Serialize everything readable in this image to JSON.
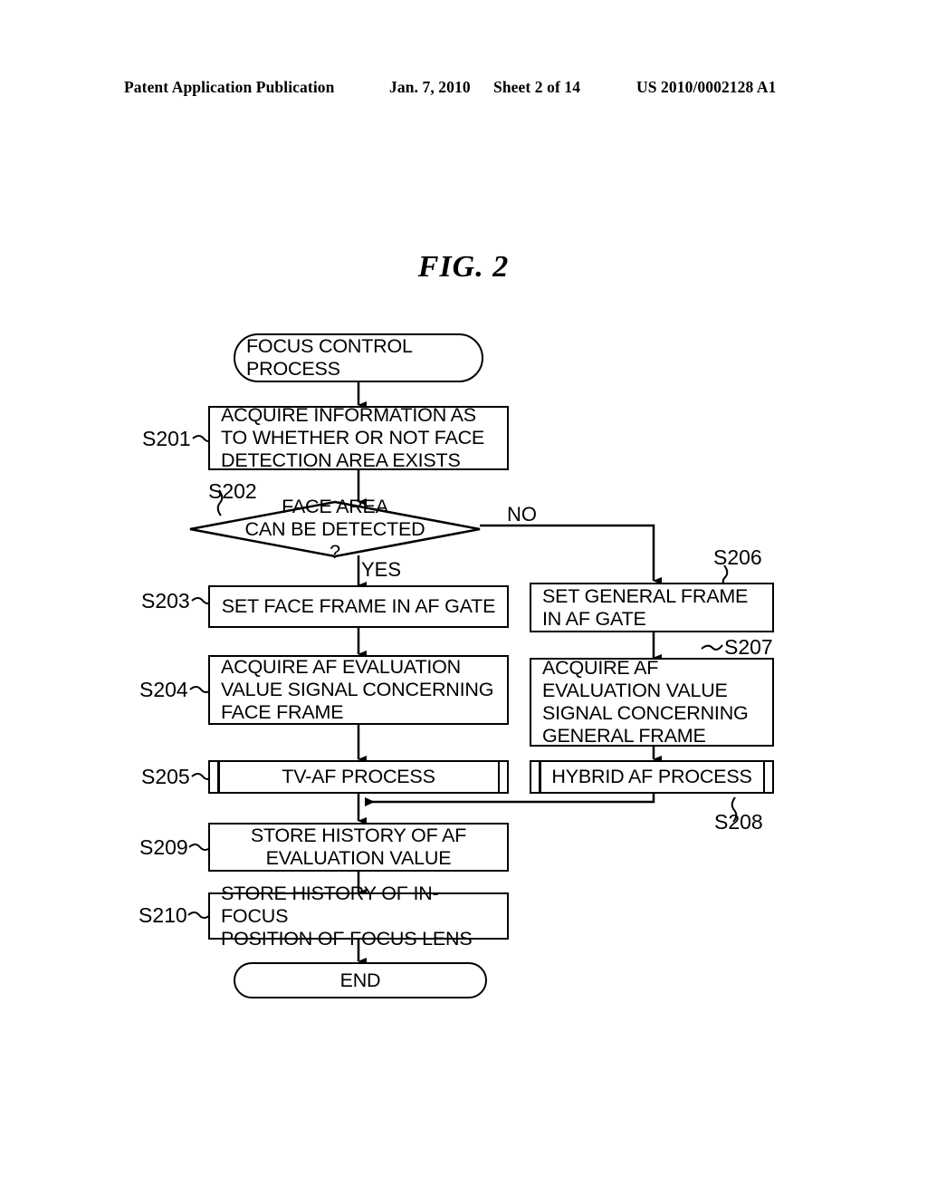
{
  "header": {
    "publication": "Patent Application Publication",
    "date": "Jan. 7, 2010",
    "sheet": "Sheet 2 of 14",
    "patent_number": "US 2010/0002128 A1"
  },
  "figure": {
    "caption": "FIG. 2"
  },
  "flowchart": {
    "start": {
      "label": "FOCUS CONTROL\nPROCESS"
    },
    "end": {
      "label": "END"
    },
    "steps": [
      {
        "ref": "S201",
        "label": "ACQUIRE INFORMATION AS\nTO WHETHER OR NOT FACE\nDETECTION AREA EXISTS"
      },
      {
        "ref": "S202",
        "label": "FACE AREA\nCAN BE DETECTED\n?"
      },
      {
        "ref": "S203",
        "label": "SET FACE FRAME IN AF GATE"
      },
      {
        "ref": "S204",
        "label": "ACQUIRE AF EVALUATION\nVALUE SIGNAL CONCERNING\nFACE FRAME"
      },
      {
        "ref": "S205",
        "label": "TV-AF PROCESS"
      },
      {
        "ref": "S206",
        "label": "SET GENERAL FRAME\nIN AF GATE"
      },
      {
        "ref": "S207",
        "label": "ACQUIRE AF\nEVALUATION VALUE\nSIGNAL CONCERNING\nGENERAL FRAME"
      },
      {
        "ref": "S208",
        "label": "HYBRID AF PROCESS"
      },
      {
        "ref": "S209",
        "label": "STORE HISTORY OF AF\nEVALUATION VALUE"
      },
      {
        "ref": "S210",
        "label": "STORE HISTORY OF IN-FOCUS\nPOSITION OF FOCUS LENS"
      }
    ],
    "branches": {
      "yes": "YES",
      "no": "NO"
    }
  }
}
